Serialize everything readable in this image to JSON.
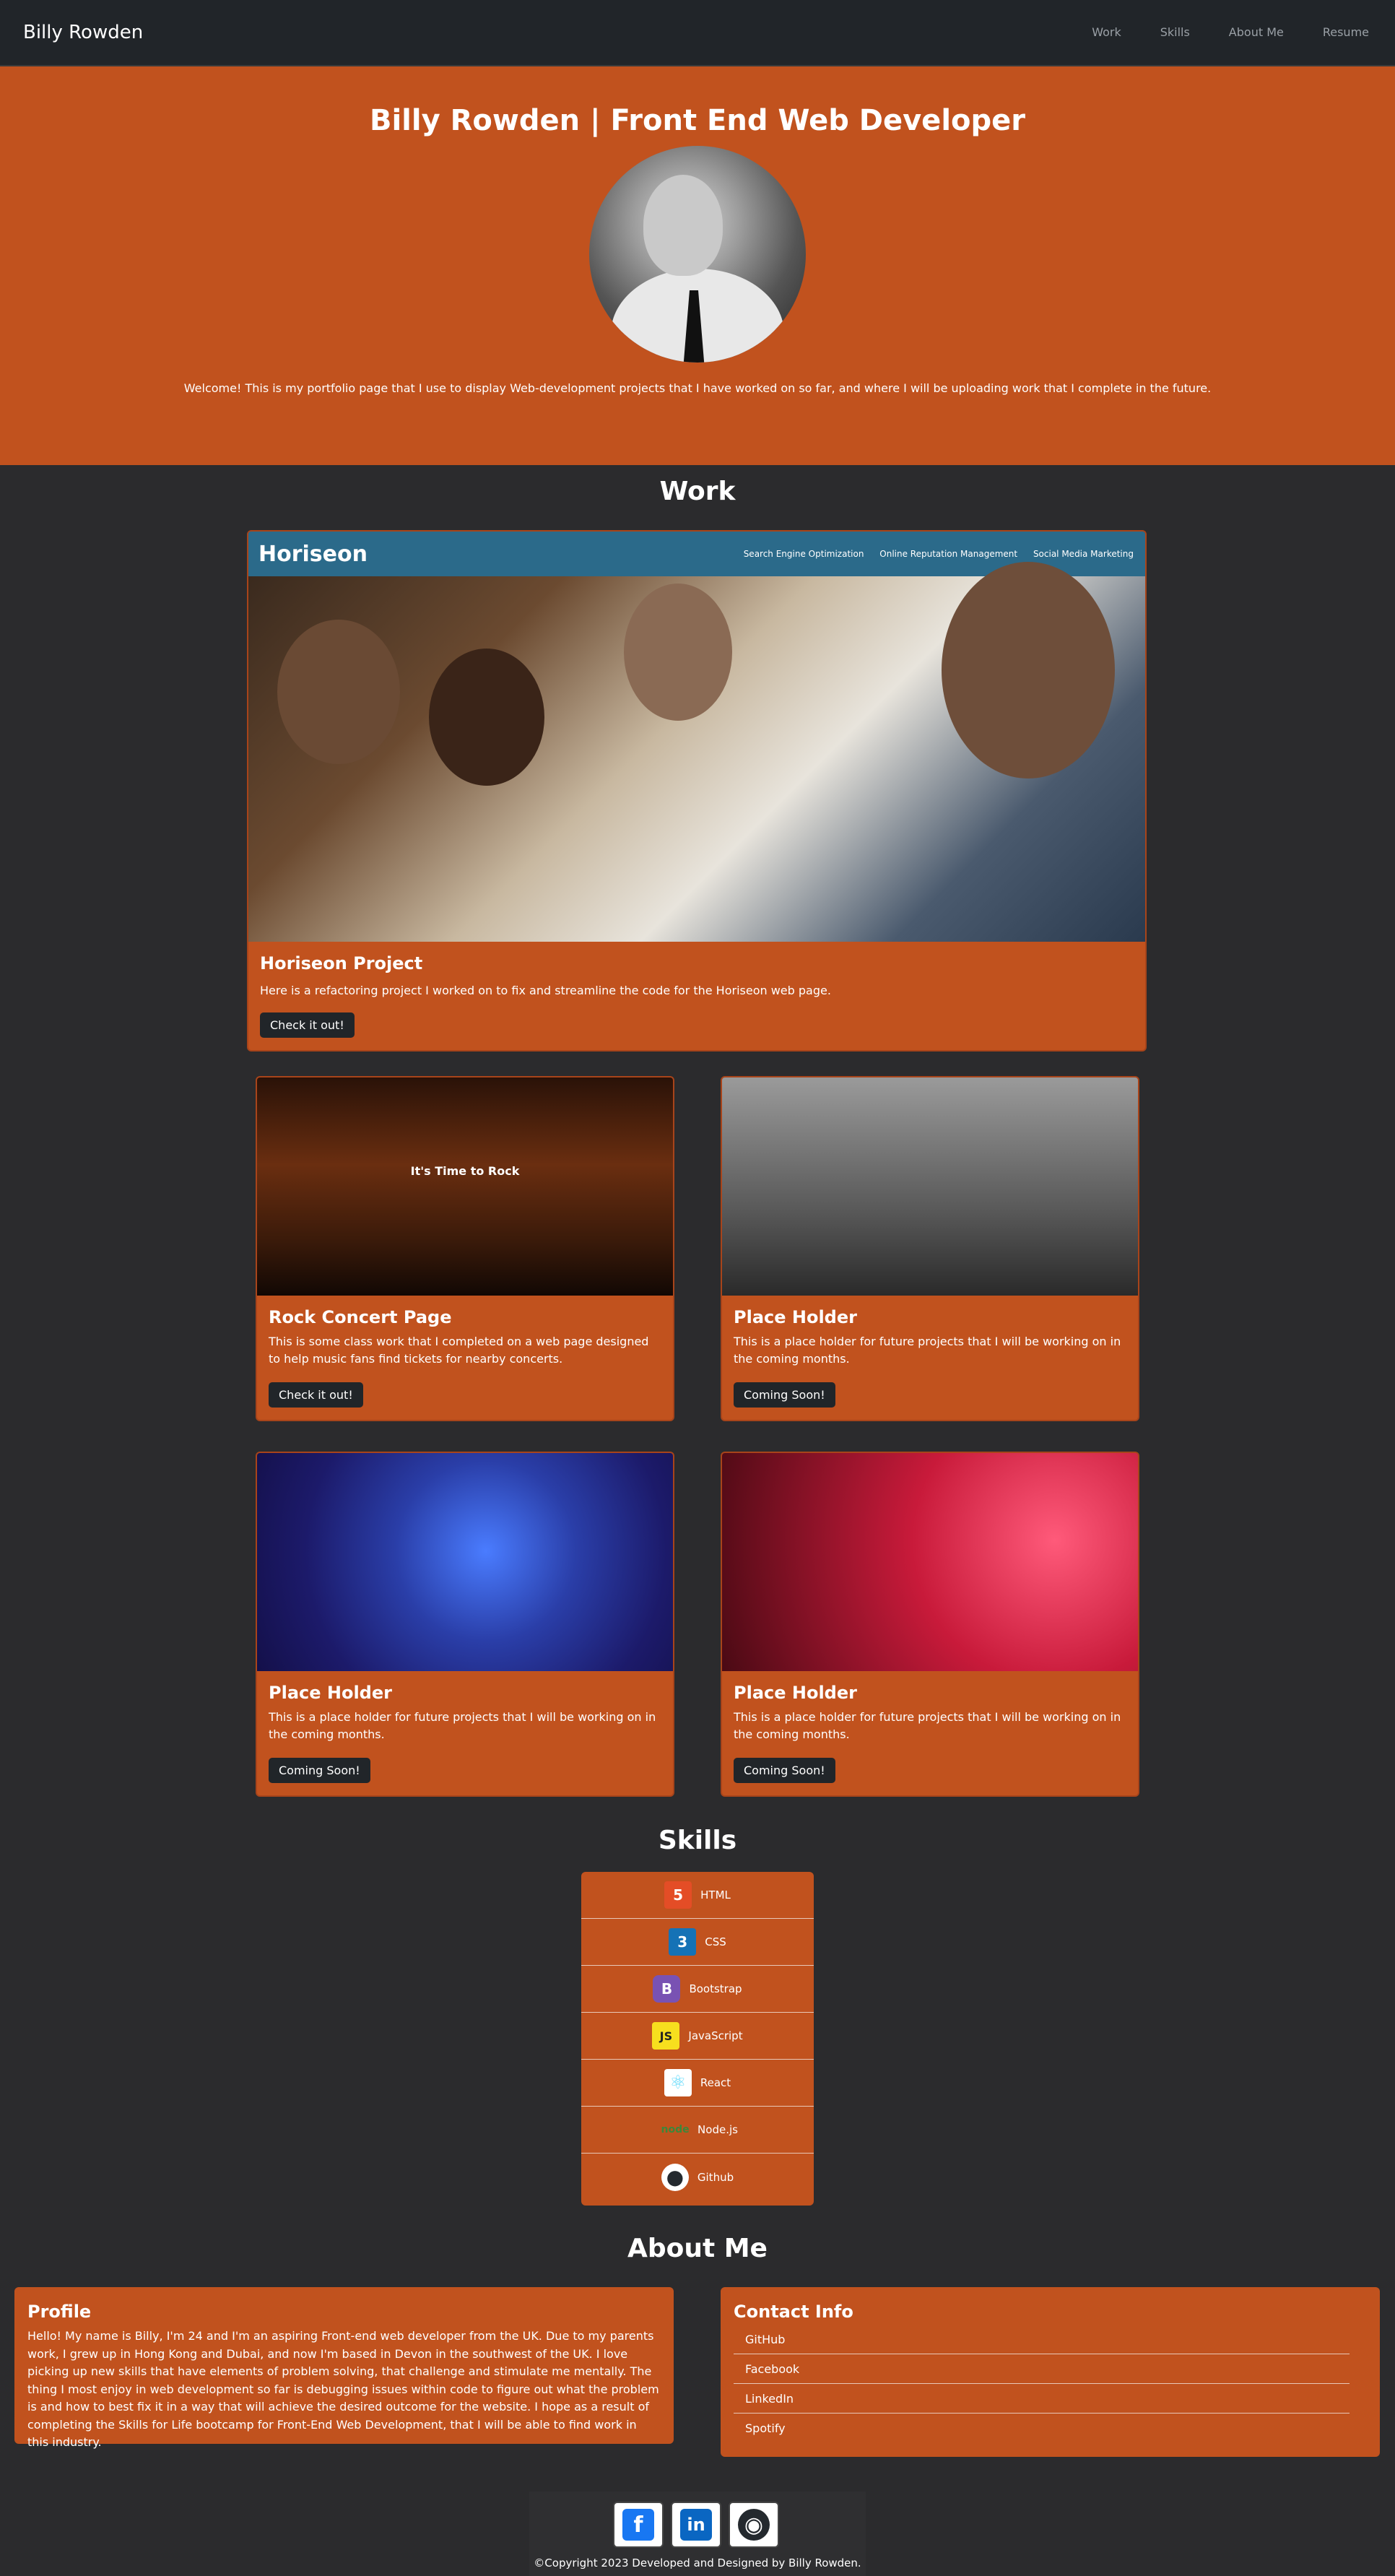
{
  "nav": {
    "brand": "Billy Rowden",
    "links": [
      "Work",
      "Skills",
      "About Me",
      "Resume"
    ]
  },
  "hero": {
    "title": "Billy Rowden | Front End Web Developer",
    "welcome": "Welcome! This is my portfolio page that I use to display Web-development projects that I have worked on so far, and where I will be uploading work that I complete in the future."
  },
  "work": {
    "title": "Work",
    "featured": {
      "title": "Horiseon Project",
      "description": "Here is a refactoring project I worked on to fix and streamline the code for the Horiseon web page.",
      "button": "Check it out!",
      "preview": {
        "logo": "Horiseon",
        "links": [
          "Search Engine Optimization",
          "Online Reputation Management",
          "Social Media Marketing"
        ]
      }
    },
    "cards": [
      {
        "title": "Rock Concert Page",
        "description": "This is some class work that I completed on a web page designed to help music fans find tickets for nearby concerts.",
        "button": "Check it out!",
        "preview_text": "It's Time to Rock"
      },
      {
        "title": "Place Holder",
        "description": "This is a place holder for future projects that I will be working on in the coming months.",
        "button": "Coming Soon!"
      },
      {
        "title": "Place Holder",
        "description": "This is a place holder for future projects that I will be working on in the coming months.",
        "button": "Coming Soon!"
      },
      {
        "title": "Place Holder",
        "description": "This is a place holder for future projects that I will be working on in the coming months.",
        "button": "Coming Soon!"
      }
    ]
  },
  "skills": {
    "title": "Skills",
    "items": [
      {
        "name": "HTML",
        "icon": "html5-icon",
        "glyph": "5",
        "color": "#e44d26"
      },
      {
        "name": "CSS",
        "icon": "css3-icon",
        "glyph": "3",
        "color": "#1572b6"
      },
      {
        "name": "Bootstrap",
        "icon": "bootstrap-icon",
        "glyph": "B",
        "color": "#7952b3"
      },
      {
        "name": "JavaScript",
        "icon": "javascript-icon",
        "glyph": "JS",
        "color": "#f7df1e"
      },
      {
        "name": "React",
        "icon": "react-icon",
        "glyph": "⚛",
        "color": "#ffffff"
      },
      {
        "name": "Node.js",
        "icon": "nodejs-icon",
        "glyph": "node",
        "color": "#3c873a"
      },
      {
        "name": "Github",
        "icon": "github-icon",
        "glyph": "●",
        "color": "#ffffff"
      }
    ]
  },
  "about": {
    "title": "About Me",
    "profile": {
      "title": "Profile",
      "text": "Hello! My name is Billy, I'm 24 and I'm an aspiring Front-end web developer from the UK. Due to my parents work, I grew up in Hong Kong and Dubai, and now I'm based in Devon in the southwest of the UK. I love picking up new skills that have elements of problem solving, that challenge and stimulate me mentally. The thing I most enjoy in web development so far is debugging issues within code to figure out what the problem is and how to best fix it in a way that will achieve the desired outcome for the website. I hope as a result of completing the Skills for Life bootcamp for Front-End Web Development, that I will be able to find work in this industry."
    },
    "contact": {
      "title": "Contact Info",
      "items": [
        "GitHub",
        "Facebook",
        "LinkedIn",
        "Spotify"
      ]
    }
  },
  "footer": {
    "social": [
      {
        "icon": "facebook-icon",
        "glyph": "f",
        "color": "#1877f2"
      },
      {
        "icon": "linkedin-icon",
        "glyph": "in",
        "color": "#0a66c2"
      },
      {
        "icon": "github-icon",
        "glyph": "◉",
        "color": "#24292e"
      }
    ],
    "copyright": "©Copyright 2023 Developed and Designed by Billy Rowden."
  }
}
